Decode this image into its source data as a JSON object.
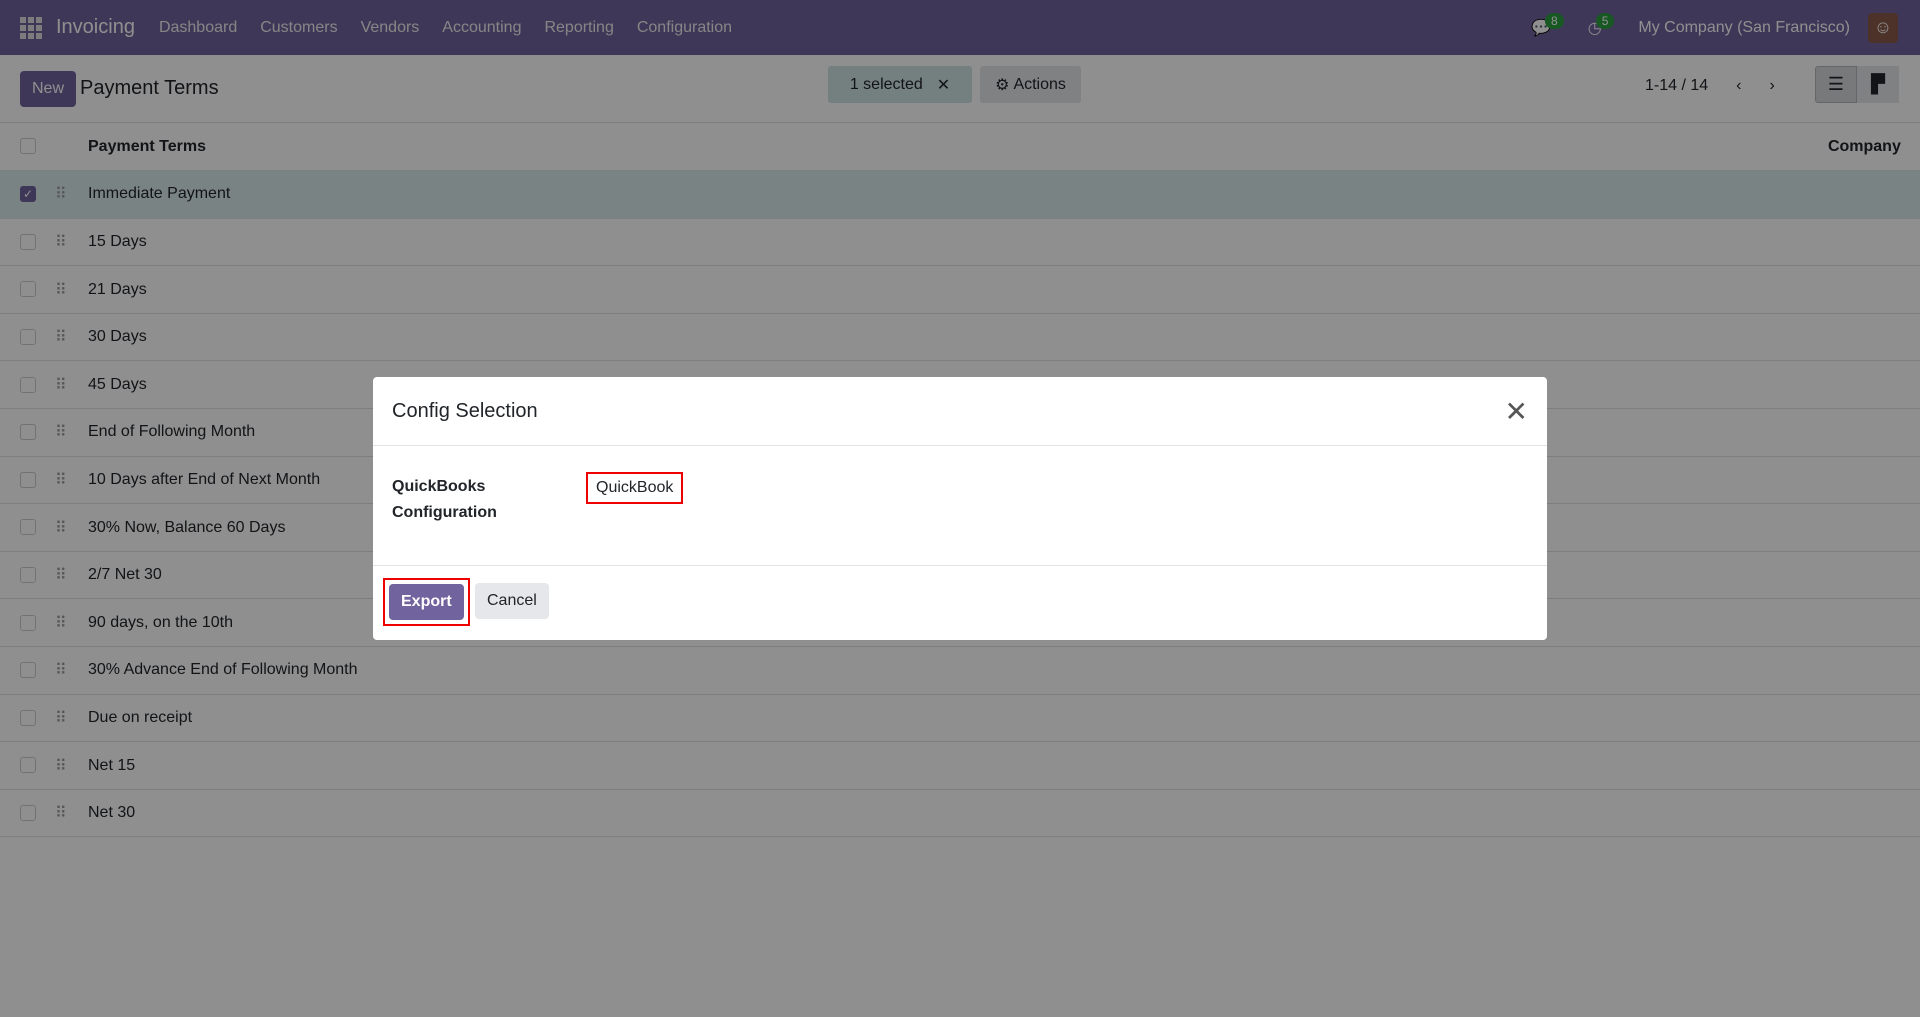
{
  "navbar": {
    "app": "Invoicing",
    "menu": [
      "Dashboard",
      "Customers",
      "Vendors",
      "Accounting",
      "Reporting",
      "Configuration"
    ],
    "messages_count": "8",
    "activities_count": "5",
    "company": "My Company (San Francisco)"
  },
  "control_panel": {
    "new_label": "New",
    "title": "Payment Terms",
    "selected": "1 selected",
    "actions": "Actions",
    "pager": "1-14 / 14"
  },
  "table": {
    "headers": [
      "Payment Terms",
      "Company"
    ],
    "rows": [
      "Immediate Payment",
      "15 Days",
      "21 Days",
      "30 Days",
      "45 Days",
      "End of Following Month",
      "10 Days after End of Next Month",
      "30% Now, Balance 60 Days",
      "2/7 Net 30",
      "90 days, on the 10th",
      "30% Advance End of Following Month",
      "Due on receipt",
      "Net 15",
      "Net 30"
    ]
  },
  "modal": {
    "title": "Config Selection",
    "field_label": "QuickBooks Configuration",
    "field_value": "QuickBook",
    "export": "Export",
    "cancel": "Cancel"
  }
}
